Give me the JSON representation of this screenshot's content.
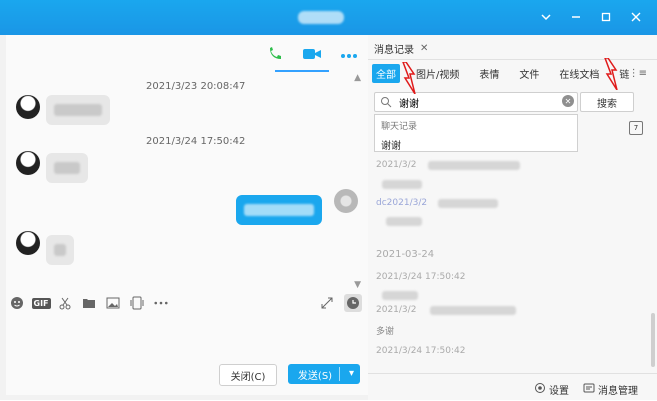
{
  "chat": {
    "timestamps": [
      "2021/3/23 20:08:47",
      "2021/3/24 17:50:42"
    ],
    "close_label": "关闭(C)",
    "send_label": "发送(S)"
  },
  "history": {
    "tab_label": "消息记录",
    "filters": [
      "全部",
      "图片/视频",
      "表情",
      "文件",
      "在线文档",
      "链"
    ],
    "search_value": "谢谢",
    "search_button": "搜索",
    "dropdown_header": "聊天记录",
    "dropdown_item": "谢谢",
    "results": [
      {
        "label": "2021/3/2"
      },
      {
        "label": "dc2021/3/2"
      },
      {
        "label": "2021-03-24"
      },
      {
        "label": "2021/3/24 17:50:42"
      },
      {
        "label": "2021/3/2"
      },
      {
        "label": "多谢"
      },
      {
        "label": "2021/3/24 17:50:42"
      }
    ],
    "bottom": {
      "settings": "设置",
      "manager": "消息管理"
    }
  },
  "colors": {
    "accent": "#1aa7ee",
    "titlebar": "#1a96e6",
    "annotation": "#e01b1b"
  },
  "icons": [
    "phone-icon",
    "video-icon",
    "more-icon",
    "emoji-icon",
    "gif-icon",
    "scissors-icon",
    "folder-icon",
    "image-icon",
    "screen-icon",
    "more-icon",
    "expand-icon",
    "clock-icon",
    "search-icon",
    "clear-icon",
    "calendar-icon",
    "settings-icon",
    "manager-icon"
  ]
}
